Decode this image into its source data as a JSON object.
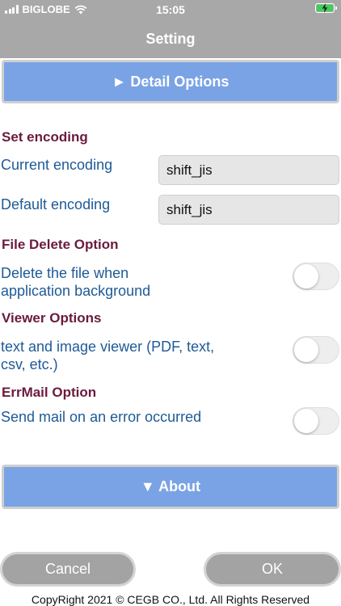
{
  "status": {
    "carrier": "BIGLOBE",
    "time": "15:05"
  },
  "nav": {
    "title": "Setting"
  },
  "detail_button": {
    "label": "► Detail Options"
  },
  "sections": {
    "encoding": {
      "title": "Set encoding",
      "current_label": "Current encoding",
      "current_value": "shift_jis",
      "default_label": "Default encoding",
      "default_value": "shift_jis"
    },
    "file_delete": {
      "title": "File Delete Option",
      "line1": "Delete the file when",
      "line2": "application background",
      "enabled": false
    },
    "viewer": {
      "title": "Viewer Options",
      "line1": "text and image viewer (PDF, text,",
      "line2": "csv, etc.)",
      "enabled": false
    },
    "errmail": {
      "title": "ErrMail Option",
      "label": "Send mail on an error occurred",
      "enabled": false
    }
  },
  "about_button": {
    "label": "▼ About"
  },
  "buttons": {
    "cancel": "Cancel",
    "ok": "OK"
  },
  "footer": {
    "copyright": "CopyRight 2021 © CEGB CO., Ltd. All Rights Reserved"
  },
  "colors": {
    "header_gray": "#a8a8a8",
    "button_blue": "#7aa3e5",
    "section_title": "#6b1a3d",
    "label_blue": "#1e5a97"
  }
}
